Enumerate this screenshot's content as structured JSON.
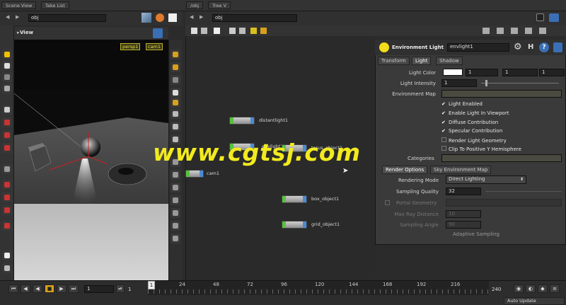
{
  "tabs": {
    "scene_view": "Scene View",
    "take_list": "Take List",
    "obj_tab": "/obj",
    "tree_view": "Tree V"
  },
  "path": {
    "left": "obj",
    "right": "obj"
  },
  "viewport": {
    "title": "View",
    "camera": "persp1",
    "cam_menu": "cam1"
  },
  "network": {
    "nodes": [
      {
        "name": "distantlight1"
      },
      {
        "name": "envlight1"
      },
      {
        "name": "torus_object1"
      },
      {
        "name": "cam1"
      },
      {
        "name": "box_object1"
      },
      {
        "name": "grid_object1"
      }
    ]
  },
  "params": {
    "type": "Environment Light",
    "node_name": "envlight1",
    "h_label": "H",
    "help_label": "?",
    "tabs": [
      "Transform",
      "Light",
      "Shadow"
    ],
    "light_color_label": "Light Color",
    "light_color": [
      "1",
      "1",
      "1"
    ],
    "light_intensity_label": "Light Intensity",
    "light_intensity": "1",
    "env_map_label": "Environment Map",
    "checks": [
      "Light Enabled",
      "Enable Light In Viewport",
      "Diffuse Contribution",
      "Specular Contribution",
      "Render Light Geometry",
      "Clip To Positive Y Hemisphere"
    ],
    "checked": [
      true,
      true,
      true,
      true,
      false,
      false
    ],
    "categories_label": "Categories",
    "sub_tabs": [
      "Render Options",
      "Sky Environment Map"
    ],
    "rendering_mode_label": "Rendering Mode",
    "rendering_mode": "Direct Lighting",
    "sampling_quality_label": "Sampling Quality",
    "sampling_quality": "32",
    "portal_label": "Portal Geometry",
    "max_ray_label": "Max Ray Distance",
    "max_ray": "10",
    "sampling_angle_label": "Sampling Angle",
    "sampling_angle": "90",
    "adaptive_label": "Adaptive Sampling"
  },
  "watermark": "www.cgtsj.com",
  "timeline": {
    "frame": "1",
    "start": "1",
    "end": "1",
    "ticks": [
      "1",
      "24",
      "48",
      "72",
      "96",
      "120",
      "144",
      "168",
      "192",
      "216"
    ],
    "end_frame": "240",
    "auto_update": "Auto Update"
  },
  "colors": {
    "accent": "#f2dc1c",
    "node_green": "#57c23c",
    "node_blue": "#4b8bd6"
  }
}
